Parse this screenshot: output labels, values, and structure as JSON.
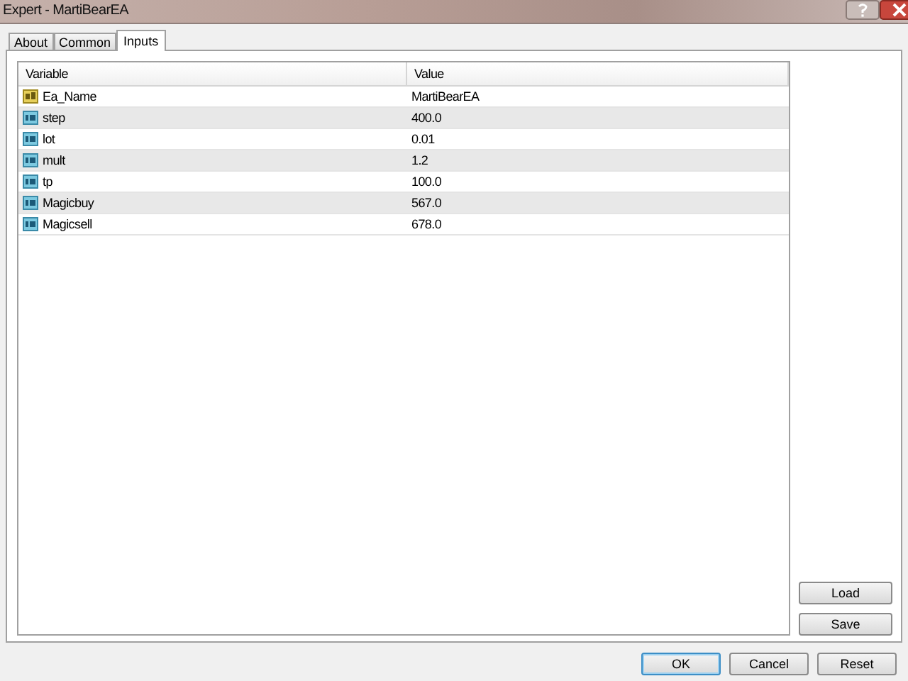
{
  "window": {
    "title": "Expert - MartiBearEA"
  },
  "tabs": [
    {
      "label": "About",
      "selected": false
    },
    {
      "label": "Common",
      "selected": false
    },
    {
      "label": "Inputs",
      "selected": true
    }
  ],
  "table": {
    "columns": [
      "Variable",
      "Value"
    ],
    "rows": [
      {
        "kind": "string",
        "variable": "Ea_Name",
        "value": "MartiBearEA"
      },
      {
        "kind": "number",
        "variable": "step",
        "value": "400.0"
      },
      {
        "kind": "number",
        "variable": "lot",
        "value": "0.01"
      },
      {
        "kind": "number",
        "variable": "mult",
        "value": "1.2"
      },
      {
        "kind": "number",
        "variable": "tp",
        "value": "100.0"
      },
      {
        "kind": "number",
        "variable": "Magicbuy",
        "value": "567.0"
      },
      {
        "kind": "number",
        "variable": "Magicsell",
        "value": "678.0"
      }
    ]
  },
  "side_buttons": [
    "Load",
    "Save"
  ],
  "buttons": [
    {
      "label": "OK",
      "default": true
    },
    {
      "label": "Cancel",
      "default": false
    },
    {
      "label": "Reset",
      "default": false
    }
  ]
}
